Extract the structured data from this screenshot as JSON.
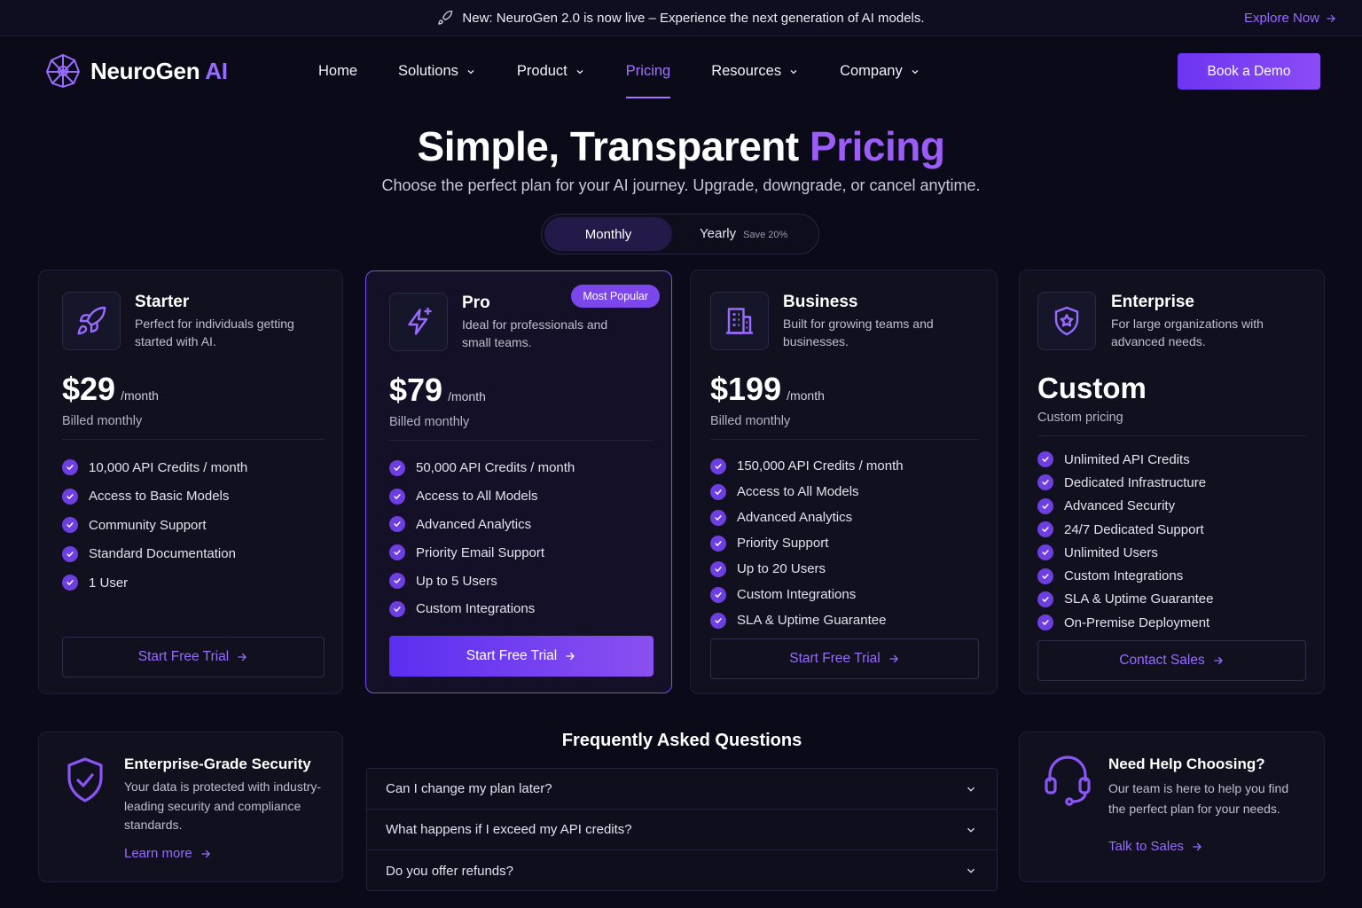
{
  "announcement": {
    "text": "New: NeuroGen 2.0 is now live – Experience the next generation of AI models.",
    "link": "Explore Now"
  },
  "nav": {
    "logo_main": "NeuroGen",
    "logo_accent": "AI",
    "items": [
      {
        "label": "Home",
        "dropdown": false
      },
      {
        "label": "Solutions",
        "dropdown": true
      },
      {
        "label": "Product",
        "dropdown": true
      },
      {
        "label": "Pricing",
        "dropdown": false,
        "active": true
      },
      {
        "label": "Resources",
        "dropdown": true
      },
      {
        "label": "Company",
        "dropdown": true
      }
    ],
    "cta": "Book a Demo"
  },
  "hero": {
    "title_main": "Simple, Transparent",
    "title_accent": "Pricing",
    "subtitle": "Choose the perfect plan for your AI journey. Upgrade, downgrade, or cancel anytime."
  },
  "billing_toggle": {
    "monthly": "Monthly",
    "yearly": "Yearly",
    "save": "Save 20%",
    "selected": "Monthly"
  },
  "plans": [
    {
      "name": "Starter",
      "icon": "rocket-icon",
      "description": "Perfect for individuals getting started with AI.",
      "price": "$29",
      "unit": "/month",
      "billed": "Billed monthly",
      "features": [
        "10,000 API Credits / month",
        "Access to Basic Models",
        "Community Support",
        "Standard Documentation",
        "1 User"
      ],
      "cta": "Start Free Trial"
    },
    {
      "name": "Pro",
      "icon": "sparkle-bolt-icon",
      "badge": "Most Popular",
      "description": "Ideal for professionals and small teams.",
      "price": "$79",
      "unit": "/month",
      "billed": "Billed monthly",
      "features": [
        "50,000 API Credits / month",
        "Access to All Models",
        "Advanced Analytics",
        "Priority Email Support",
        "Up to 5 Users",
        "Custom Integrations"
      ],
      "cta": "Start Free Trial"
    },
    {
      "name": "Business",
      "icon": "building-icon",
      "description": "Built for growing teams and businesses.",
      "price": "$199",
      "unit": "/month",
      "billed": "Billed monthly",
      "features": [
        "150,000 API Credits / month",
        "Access to All Models",
        "Advanced Analytics",
        "Priority Support",
        "Up to 20 Users",
        "Custom Integrations",
        "SLA & Uptime Guarantee"
      ],
      "cta": "Start Free Trial"
    },
    {
      "name": "Enterprise",
      "icon": "shield-star-icon",
      "description": "For large organizations with advanced needs.",
      "price": "Custom",
      "billed": "Custom pricing",
      "features": [
        "Unlimited API Credits",
        "Dedicated Infrastructure",
        "Advanced Security",
        "24/7 Dedicated Support",
        "Unlimited Users",
        "Custom Integrations",
        "SLA & Uptime Guarantee",
        "On-Premise Deployment"
      ],
      "cta": "Contact Sales"
    }
  ],
  "security": {
    "title": "Enterprise-Grade Security",
    "text": "Your data is protected with industry-leading security and compliance standards.",
    "link": "Learn more"
  },
  "faq": {
    "title": "Frequently Asked Questions",
    "items": [
      "Can I change my plan later?",
      "What happens if I exceed my API credits?",
      "Do you offer refunds?"
    ]
  },
  "help": {
    "title": "Need Help Choosing?",
    "text": "Our team is here to help you find the perfect plan for your needs.",
    "link": "Talk to Sales"
  },
  "colors": {
    "background": "#0a0a18",
    "accent": "#9a6bff",
    "primary": "#6d35f0"
  }
}
